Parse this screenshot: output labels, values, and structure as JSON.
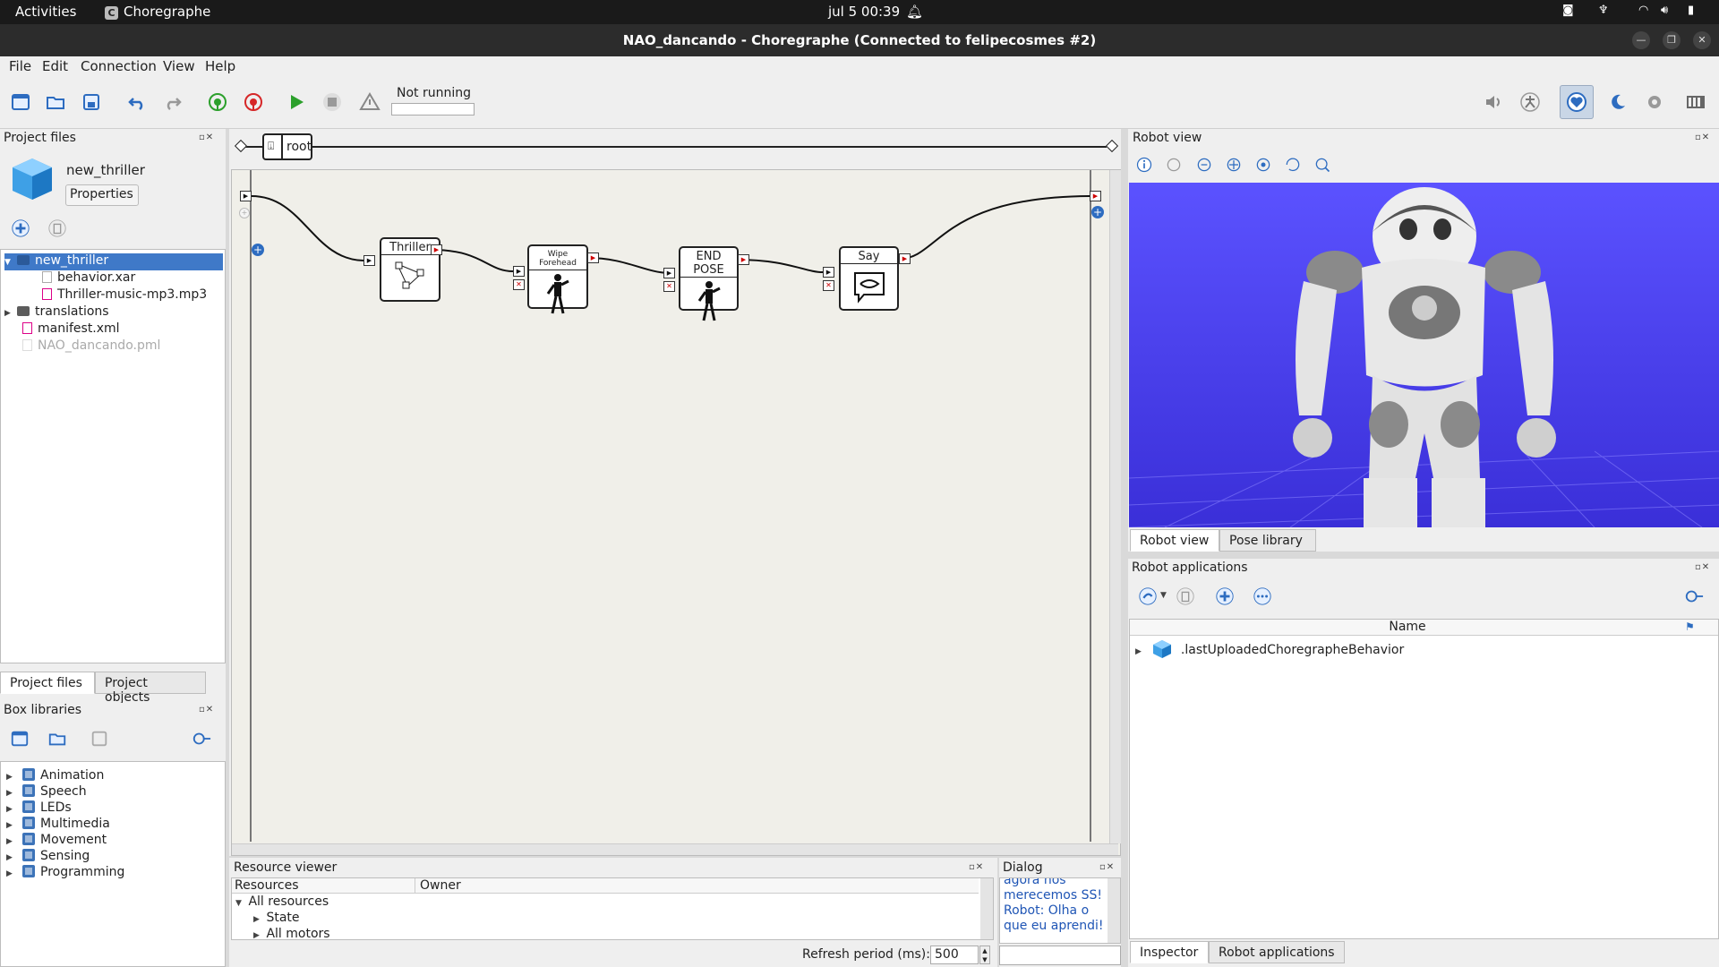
{
  "topbar": {
    "activities": "Activities",
    "app_name": "Choregraphe",
    "app_icon_letter": "C",
    "datetime": "jul 5  00:39"
  },
  "window": {
    "title": "NAO_dancando - Choregraphe (Connected to felipecosmes #2)"
  },
  "menu": [
    "File",
    "Edit",
    "Connection",
    "View",
    "Help"
  ],
  "toolbar": {
    "status": "Not running"
  },
  "project_files": {
    "panel_title": "Project files",
    "project_name": "new_thriller",
    "properties_button": "Properties",
    "tree": [
      {
        "label": "new_thriller",
        "selected": true
      },
      {
        "label": "behavior.xar"
      },
      {
        "label": "Thriller-music-mp3.mp3"
      },
      {
        "label": "translations"
      },
      {
        "label": "manifest.xml"
      },
      {
        "label": "NAO_dancando.pml"
      }
    ],
    "tabs": [
      "Project files",
      "Project objects"
    ]
  },
  "box_libraries": {
    "panel_title": "Box libraries",
    "items": [
      "Animation",
      "Speech",
      "LEDs",
      "Multimedia",
      "Movement",
      "Sensing",
      "Programming"
    ]
  },
  "flow": {
    "breadcrumb": "root",
    "boxes": [
      "Thriller",
      "Wipe Forehead",
      "END POSE",
      "Say"
    ]
  },
  "resource_viewer": {
    "panel_title": "Resource viewer",
    "columns": [
      "Resources",
      "Owner"
    ],
    "rows": [
      "All resources",
      "State",
      "All motors"
    ],
    "refresh_label": "Refresh period (ms):",
    "refresh_value": "500"
  },
  "dialog": {
    "panel_title": "Dialog",
    "text_lines": [
      "agora nós",
      "merecemos SS!",
      "Robot: Olha o",
      "que eu aprendi!"
    ]
  },
  "robot_view": {
    "panel_title": "Robot view",
    "tabs": [
      "Robot view",
      "Pose library"
    ],
    "bg_color": "#4a3ff0"
  },
  "robot_apps": {
    "panel_title": "Robot applications",
    "column": "Name",
    "items": [
      ".lastUploadedChoregrapheBehavior"
    ],
    "bottom_tabs": [
      "Inspector",
      "Robot applications"
    ]
  }
}
